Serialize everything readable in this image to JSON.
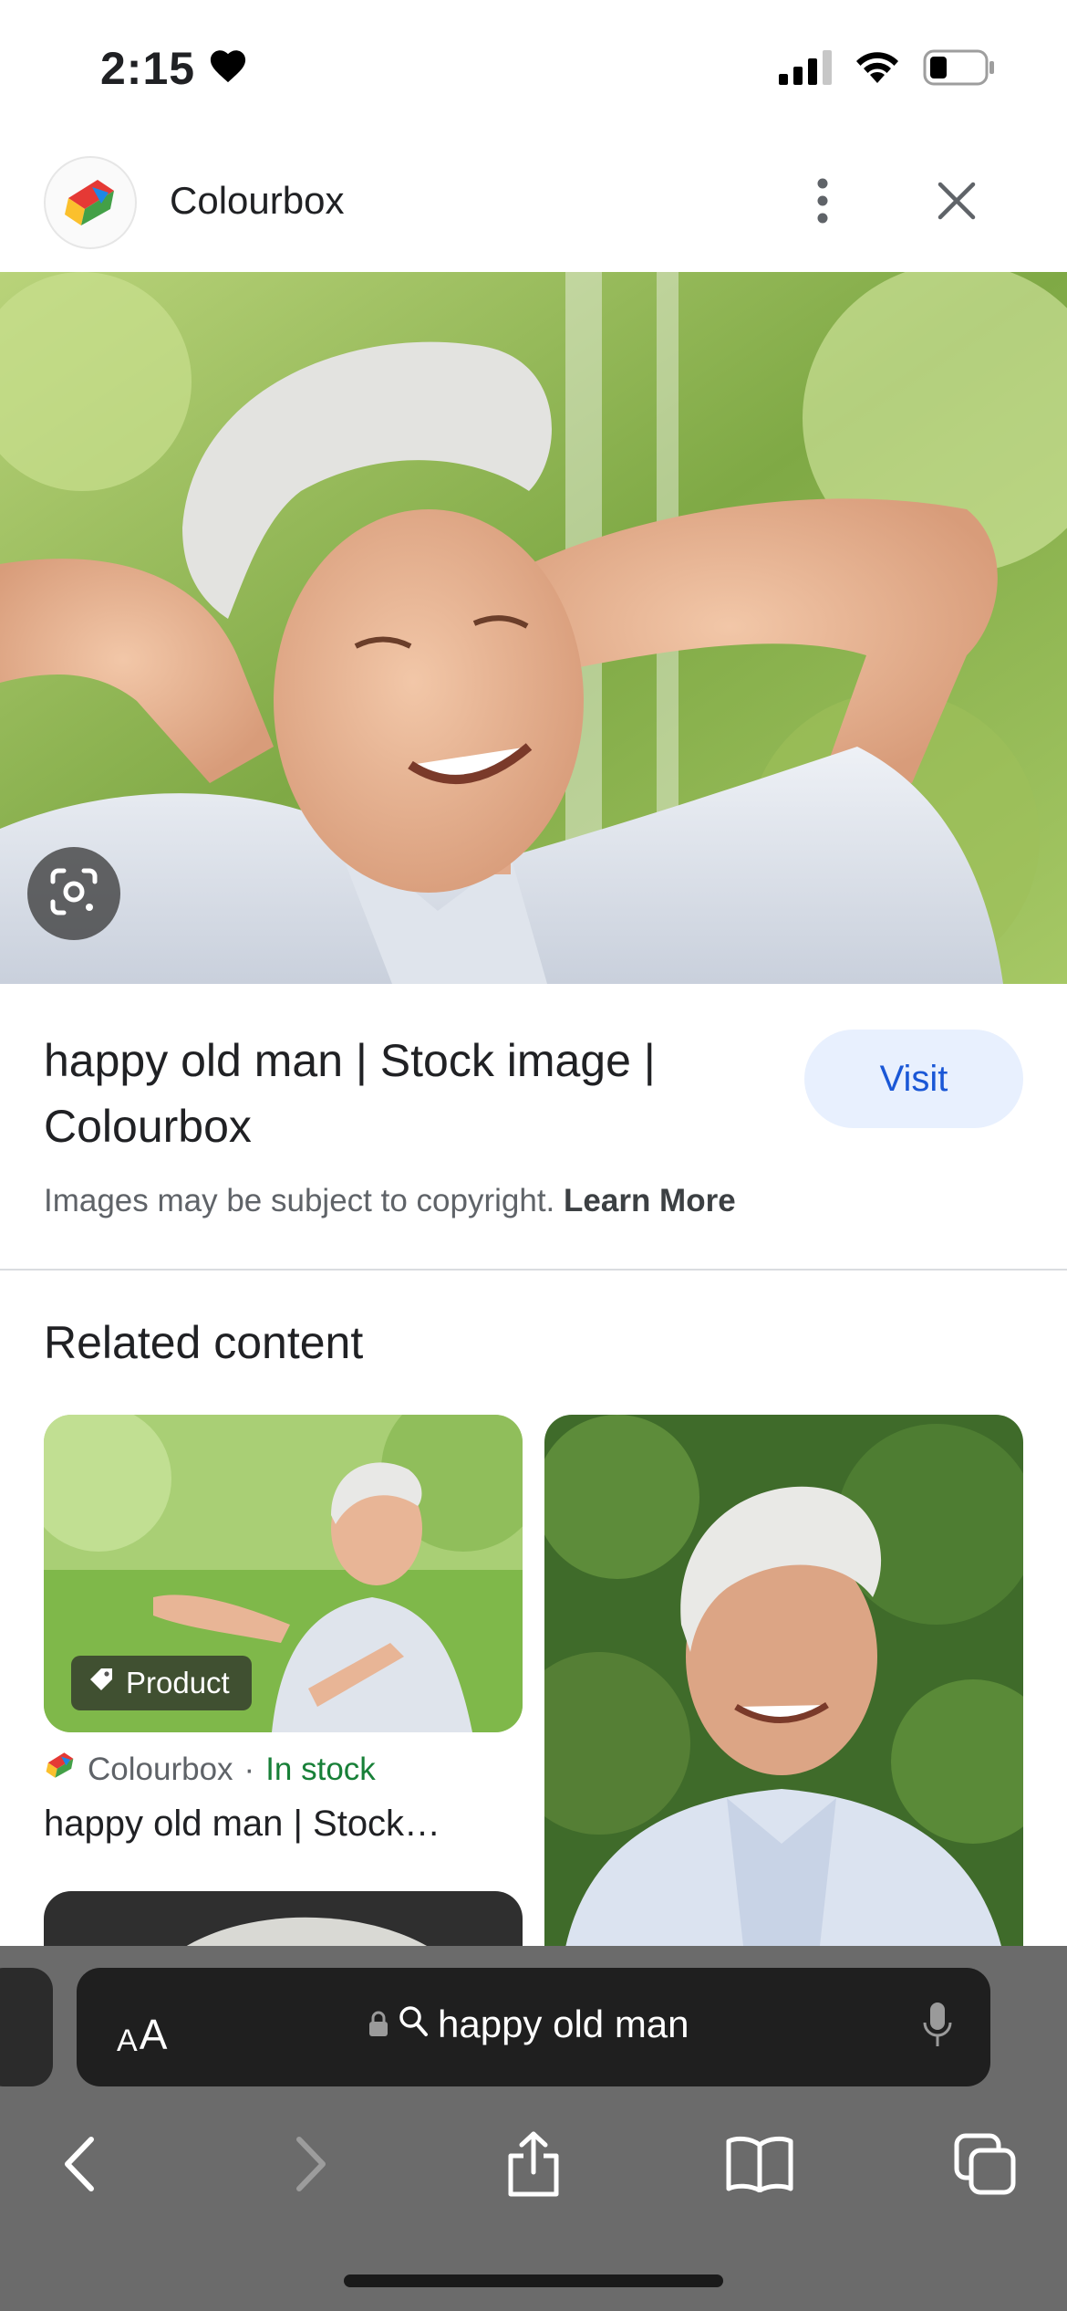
{
  "status_bar": {
    "time": "2:15"
  },
  "header": {
    "site_name": "Colourbox"
  },
  "image_result": {
    "title": "happy old man | Stock image | Colourbox",
    "visit_label": "Visit",
    "copyright_text": "Images may be subject to copyright.",
    "learn_more_label": "Learn More"
  },
  "related": {
    "heading": "Related content",
    "cards": [
      {
        "badge": "Product",
        "source": "Colourbox",
        "separator": "·",
        "availability": "In stock",
        "title": "happy old man | Stock…"
      }
    ]
  },
  "browser": {
    "text_size_label_small": "A",
    "text_size_label_large": "A",
    "search_query": "happy old man"
  },
  "colors": {
    "visit_bg": "#e8f0fe",
    "visit_text": "#1a57d6",
    "in_stock": "#188038",
    "chrome_bg": "#6b6b6b",
    "address_bg": "#1f1f1f"
  },
  "icons": {
    "heart": "heart-icon",
    "signal": "cellular-signal-icon",
    "wifi": "wifi-icon",
    "battery": "battery-icon",
    "more": "more-vertical-icon",
    "close": "close-icon",
    "lens": "google-lens-icon",
    "tag": "tag-icon",
    "lock": "lock-icon",
    "search": "search-icon",
    "mic": "microphone-icon",
    "back": "back-arrow-icon",
    "forward": "forward-arrow-icon",
    "share": "share-icon",
    "bookmarks": "bookmarks-icon",
    "tabs": "tabs-icon"
  }
}
